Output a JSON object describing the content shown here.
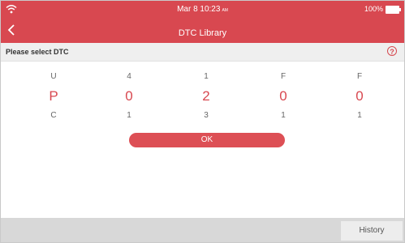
{
  "status_bar": {
    "datetime": "Mar 8 10:23",
    "ampm": "AM",
    "battery": "100%"
  },
  "header": {
    "title": "DTC Library"
  },
  "subheader": {
    "prompt": "Please select DTC"
  },
  "picker": {
    "columns": [
      {
        "above": "U",
        "selected": "P",
        "below": "C"
      },
      {
        "above": "4",
        "selected": "0",
        "below": "1"
      },
      {
        "above": "1",
        "selected": "2",
        "below": "3"
      },
      {
        "above": "F",
        "selected": "0",
        "below": "1"
      },
      {
        "above": "F",
        "selected": "0",
        "below": "1"
      }
    ]
  },
  "actions": {
    "ok_label": "OK",
    "history_label": "History"
  },
  "colors": {
    "accent": "#d84850"
  }
}
